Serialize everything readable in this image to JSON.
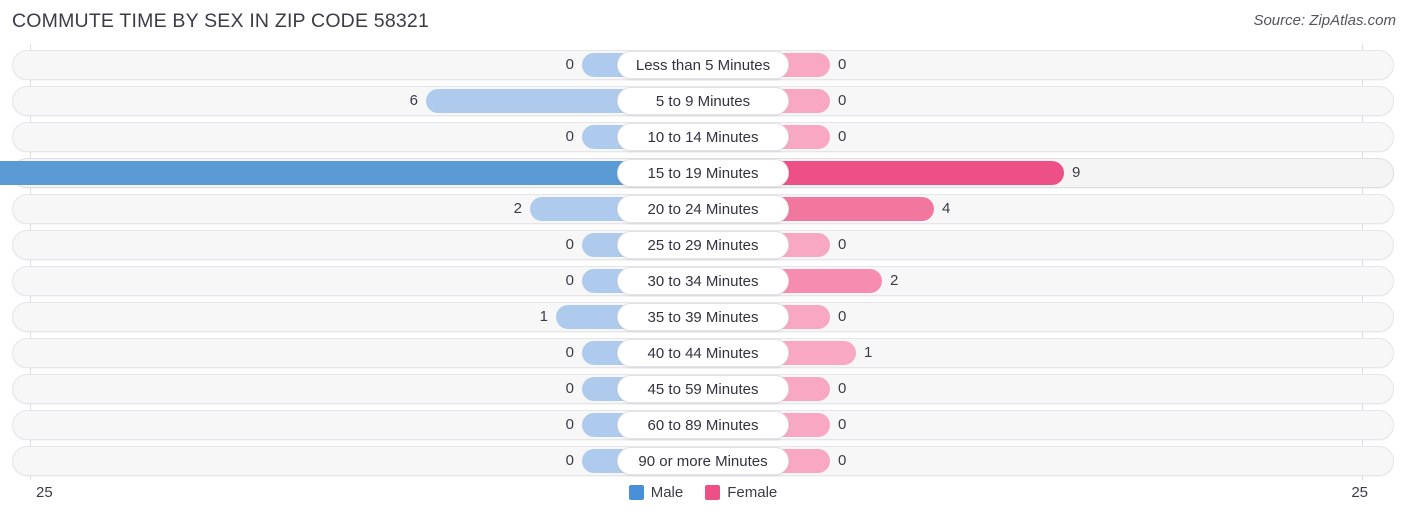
{
  "header": {
    "title": "COMMUTE TIME BY SEX IN ZIP CODE 58321",
    "source": "Source: ZipAtlas.com"
  },
  "legend": {
    "male_label": "Male",
    "female_label": "Female",
    "male_color": "#4a90d9",
    "female_color": "#ed4f87"
  },
  "axis": {
    "left_tick": "25",
    "right_tick": "25"
  },
  "chart_data": {
    "type": "bar",
    "orientation": "horizontal-diverging",
    "title": "COMMUTE TIME BY SEX IN ZIP CODE 58321",
    "xlabel": "",
    "ylabel": "",
    "xlim": [
      25,
      25
    ],
    "grid": false,
    "legend_position": "bottom-center",
    "categories": [
      "Less than 5 Minutes",
      "5 to 9 Minutes",
      "10 to 14 Minutes",
      "15 to 19 Minutes",
      "20 to 24 Minutes",
      "25 to 29 Minutes",
      "30 to 34 Minutes",
      "35 to 39 Minutes",
      "40 to 44 Minutes",
      "45 to 59 Minutes",
      "60 to 89 Minutes",
      "90 or more Minutes"
    ],
    "series": [
      {
        "name": "Male",
        "values": [
          0,
          6,
          0,
          25,
          2,
          0,
          0,
          1,
          0,
          0,
          0,
          0
        ]
      },
      {
        "name": "Female",
        "values": [
          0,
          0,
          0,
          9,
          4,
          0,
          2,
          0,
          1,
          0,
          0,
          0
        ]
      }
    ]
  },
  "rows": [
    {
      "label": "Less than 5 Minutes",
      "male": "0",
      "female": "0"
    },
    {
      "label": "5 to 9 Minutes",
      "male": "6",
      "female": "0"
    },
    {
      "label": "10 to 14 Minutes",
      "male": "0",
      "female": "0"
    },
    {
      "label": "15 to 19 Minutes",
      "male": "25",
      "female": "9"
    },
    {
      "label": "20 to 24 Minutes",
      "male": "2",
      "female": "4"
    },
    {
      "label": "25 to 29 Minutes",
      "male": "0",
      "female": "0"
    },
    {
      "label": "30 to 34 Minutes",
      "male": "0",
      "female": "2"
    },
    {
      "label": "35 to 39 Minutes",
      "male": "1",
      "female": "0"
    },
    {
      "label": "40 to 44 Minutes",
      "male": "0",
      "female": "1"
    },
    {
      "label": "45 to 59 Minutes",
      "male": "0",
      "female": "0"
    },
    {
      "label": "60 to 89 Minutes",
      "male": "0",
      "female": "0"
    },
    {
      "label": "90 or more Minutes",
      "male": "0",
      "female": "0"
    }
  ]
}
